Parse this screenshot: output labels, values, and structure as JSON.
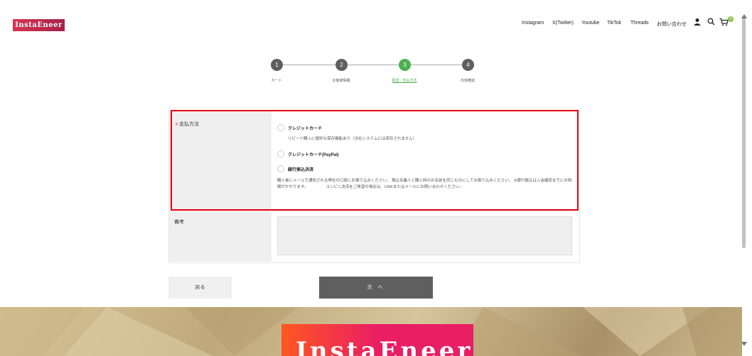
{
  "header": {
    "logo": "InstaEneer",
    "nav": [
      "Instagram",
      "X(Twitter)",
      "Youtube",
      "TikTok",
      "Threads",
      "お問い合わせ"
    ],
    "cart_count": "0"
  },
  "steps": [
    {
      "num": "1",
      "label": "カート"
    },
    {
      "num": "2",
      "label": "お客様情報"
    },
    {
      "num": "3",
      "label": "配送・支払方法"
    },
    {
      "num": "4",
      "label": "内容確認"
    }
  ],
  "form": {
    "payment_label": "支払方法",
    "required_mark": "＊",
    "options": [
      {
        "label": "クレジットカード",
        "desc": "リピート購入に便利な保存機能あり（当社システムには保存されません）"
      },
      {
        "label": "クレジットカード(PayPal)",
        "desc": ""
      },
      {
        "label": "銀行振込決済",
        "desc": "購入後にメールで通知される弊社の口座にお振り込みください。 振込名義人と購入時のお名前を同じものにしてお振り込みください。 ※銀行振込は入金確認までにお時間がかかります。　　　　　コンビニ決済をご希望の場合は、LINEまたはメールにお問い合わせください。"
      }
    ],
    "notes_label": "備考"
  },
  "buttons": {
    "back": "戻る",
    "next": "次 へ"
  },
  "footer": {
    "logo": "InstaEneer"
  }
}
